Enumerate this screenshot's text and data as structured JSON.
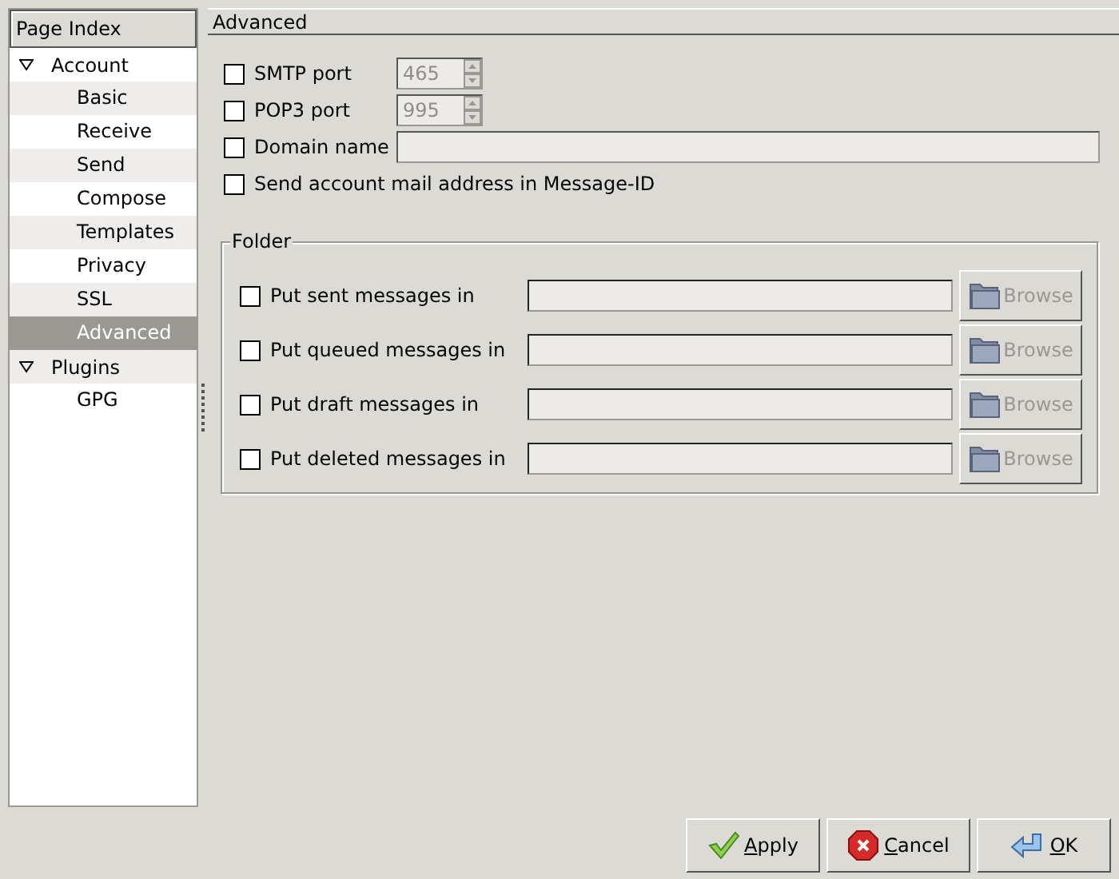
{
  "sidebar": {
    "title": "Page Index",
    "tree": [
      {
        "label": "Account",
        "expanded": true,
        "selected": false,
        "children": [
          {
            "label": "Basic",
            "selected": false
          },
          {
            "label": "Receive",
            "selected": false
          },
          {
            "label": "Send",
            "selected": false
          },
          {
            "label": "Compose",
            "selected": false
          },
          {
            "label": "Templates",
            "selected": false
          },
          {
            "label": "Privacy",
            "selected": false
          },
          {
            "label": "SSL",
            "selected": false
          },
          {
            "label": "Advanced",
            "selected": true
          }
        ]
      },
      {
        "label": "Plugins",
        "expanded": true,
        "selected": false,
        "children": [
          {
            "label": "GPG",
            "selected": false
          }
        ]
      }
    ]
  },
  "page": {
    "title": "Advanced",
    "options": [
      {
        "kind": "spin",
        "label": "SMTP port",
        "checked": false,
        "value": "465",
        "disabled": true
      },
      {
        "kind": "spin",
        "label": "POP3 port",
        "checked": false,
        "value": "995",
        "disabled": true
      },
      {
        "kind": "text",
        "label": "Domain name",
        "checked": false,
        "disabled": true
      },
      {
        "kind": "check",
        "label": "Send account mail address in Message-ID",
        "checked": false
      }
    ],
    "folder": {
      "title": "Folder",
      "rows": [
        {
          "label": "Put sent messages in",
          "checked": false,
          "button": "Browse",
          "disabled": true
        },
        {
          "label": "Put queued messages in",
          "checked": false,
          "button": "Browse",
          "disabled": true
        },
        {
          "label": "Put draft messages in",
          "checked": false,
          "button": "Browse",
          "disabled": true
        },
        {
          "label": "Put deleted messages in",
          "checked": false,
          "button": "Browse",
          "disabled": true
        }
      ]
    }
  },
  "buttons": [
    {
      "kind": "apply",
      "label": "Apply",
      "mnemonic_first": true
    },
    {
      "kind": "cancel",
      "label": "Cancel",
      "mnemonic_first": true
    },
    {
      "kind": "ok",
      "label": "OK",
      "mnemonic_first": true
    }
  ]
}
